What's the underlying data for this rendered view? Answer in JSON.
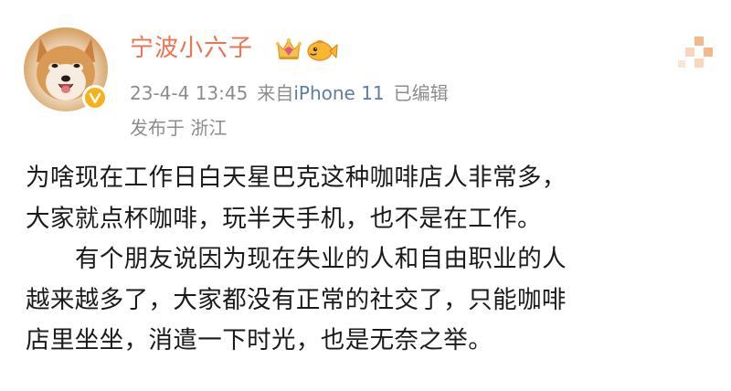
{
  "user": {
    "name": "宁波小六子",
    "avatar_icon": "shiba-dog-avatar",
    "verified_icon": "verified-v-badge",
    "badges": [
      "crown-badge-icon",
      "fish-badge-icon"
    ]
  },
  "meta": {
    "time": "23-4-4 13:45",
    "source_prefix": "来自",
    "source": "iPhone 11",
    "edited": "已编辑",
    "location": "发布于 浙江"
  },
  "content": {
    "lines": [
      "为啥现在工作日白天星巴克这种咖啡店人非常多，",
      "大家就点杯咖啡，玩半天手机，也不是在工作。",
      "有个朋友说因为现在失业的人和自由职业的人",
      "越来越多了，大家都没有正常的社交了，只能咖啡",
      "店里坐坐，消遣一下时光，也是无奈之举。"
    ]
  },
  "colors": {
    "username": "#eb7350",
    "meta": "#8c8c8c",
    "source_link": "#5b7ea6",
    "badge_gold": "#f5b21b",
    "more_icon": "#f3b98e"
  }
}
